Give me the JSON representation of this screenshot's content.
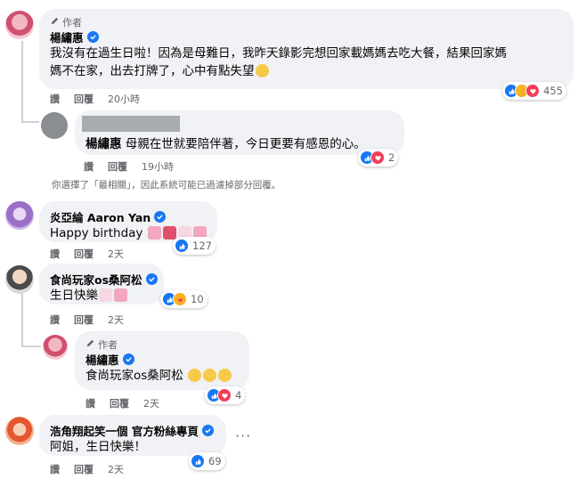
{
  "comments": [
    {
      "author_badge": "作者",
      "name": "楊繡惠",
      "text_line1": "我沒有在過生日啦！因為是母難日，我昨天錄影完想回家載媽媽去吃大餐，結果回家媽",
      "text_line2": "媽不在家，出去打牌了，心中有點失望",
      "actions": {
        "like": "讚",
        "reply": "回覆",
        "time": "20小時"
      },
      "reaction_count": "455"
    },
    {
      "mention": "楊繡惠",
      "text": " 母親在世就要陪伴著，今日更要有感恩的心。",
      "actions": {
        "like": "讚",
        "reply": "回覆",
        "time": "19小時"
      },
      "reaction_count": "2"
    },
    {
      "name": "炎亞綸 Aaron Yan",
      "text": "Happy birthday",
      "actions": {
        "like": "讚",
        "reply": "回覆",
        "time": "2天"
      },
      "reaction_count": "127"
    },
    {
      "name": "食尚玩家os桑阿松",
      "text": "生日快樂",
      "actions": {
        "like": "讚",
        "reply": "回覆",
        "time": "2天"
      },
      "reaction_count": "10"
    },
    {
      "author_badge": "作者",
      "name": "楊繡惠",
      "text": "食尚玩家os桑阿松",
      "actions": {
        "like": "讚",
        "reply": "回覆",
        "time": "2天"
      },
      "reaction_count": "4"
    },
    {
      "name": "浩角翔起笑一個 官方粉絲專頁",
      "text": "阿姐，生日快樂！",
      "actions": {
        "like": "讚",
        "reply": "回覆",
        "time": "2天"
      },
      "reaction_count": "69"
    }
  ],
  "filter_note": "你選擇了「最相關」，因此系統可能已過濾掉部分回覆。",
  "more_options": "···",
  "colors": {
    "like": "#1877f2",
    "love": "#f33e58",
    "haha": "#f7b125",
    "bubble": "#f0f2f5",
    "meta": "#65676b"
  },
  "icons": [
    "pencil-icon",
    "verified-badge-icon",
    "like-reaction-icon",
    "love-reaction-icon",
    "haha-reaction-icon",
    "care-reaction-icon",
    "more-options-icon"
  ]
}
